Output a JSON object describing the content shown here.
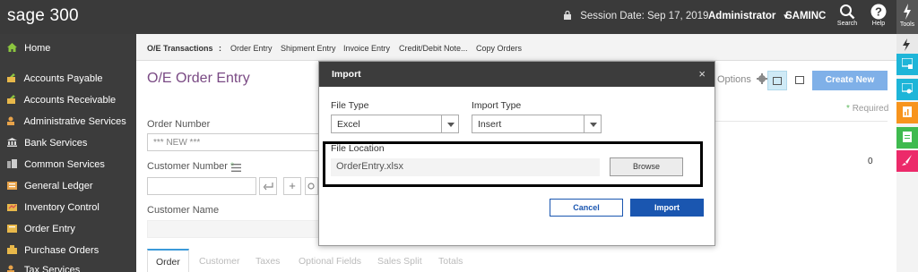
{
  "header": {
    "logo_main": "sage",
    "logo_num": "300",
    "session_label": "Session Date:",
    "session_date": "Sep 17, 2019",
    "user": "Administrator",
    "company": "SAMINC",
    "search_label": "Search",
    "help_label": "Help",
    "tools_label": "Tools"
  },
  "sidebar": {
    "items": [
      {
        "label": "Home",
        "icon": "home-icon"
      },
      {
        "label": "Accounts Payable",
        "icon": "ap-icon"
      },
      {
        "label": "Accounts Receivable",
        "icon": "ar-icon"
      },
      {
        "label": "Administrative Services",
        "icon": "admin-icon"
      },
      {
        "label": "Bank Services",
        "icon": "bank-icon"
      },
      {
        "label": "Common Services",
        "icon": "common-icon"
      },
      {
        "label": "General Ledger",
        "icon": "gl-icon"
      },
      {
        "label": "Inventory Control",
        "icon": "inventory-icon"
      },
      {
        "label": "Order Entry",
        "icon": "order-entry-icon"
      },
      {
        "label": "Purchase Orders",
        "icon": "purchase-icon"
      },
      {
        "label": "Tax Services",
        "icon": "tax-icon"
      }
    ]
  },
  "breadcrumbs": {
    "section": "O/E Transactions",
    "separator": ":",
    "items": [
      "Order Entry",
      "Shipment Entry",
      "Invoice Entry",
      "Credit/Debit Note...",
      "Copy Orders"
    ]
  },
  "page": {
    "title": "O/E Order Entry",
    "options_label": "Options",
    "create_new": "Create New",
    "required": "Required",
    "required_star": "*",
    "order_number_label": "Order Number",
    "order_number_value": "*** NEW ***",
    "customer_number_label": "Customer Number",
    "customer_star": "*",
    "customer_name_label": "Customer Name",
    "right_value": "0",
    "tabs": [
      "Order",
      "Customer",
      "Taxes",
      "Optional Fields",
      "Sales Split",
      "Totals"
    ]
  },
  "modal": {
    "title": "Import",
    "close": "×",
    "file_type_label": "File Type",
    "file_type_value": "Excel",
    "import_type_label": "Import Type",
    "import_type_value": "Insert",
    "file_location_label": "File Location",
    "file_location_value": "OrderEntry.xlsx",
    "browse": "Browse",
    "cancel": "Cancel",
    "import": "Import"
  },
  "colors": {
    "title_purple": "#7a4a84",
    "primary_blue": "#1a56b0",
    "dock_cyan": "#1eb5d8",
    "dock_orange": "#f7941d",
    "dock_green": "#3fba4f",
    "dock_pink": "#ec2a6a"
  }
}
